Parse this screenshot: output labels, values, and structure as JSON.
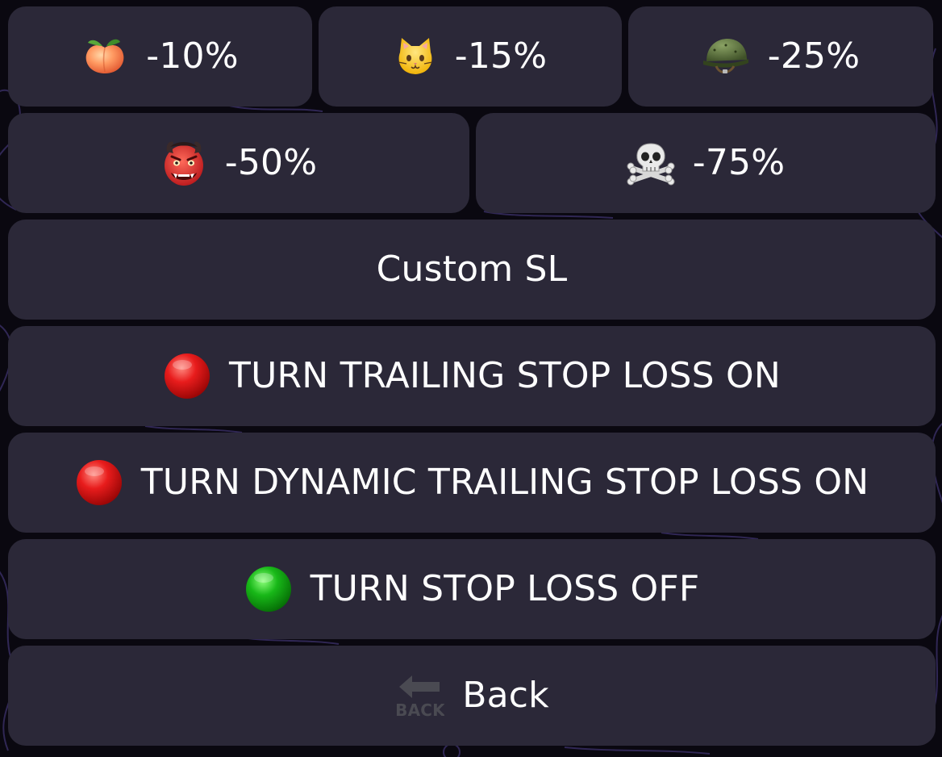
{
  "keyboard": {
    "row1": [
      {
        "icon": "peach-icon",
        "label": "-10%"
      },
      {
        "icon": "cat-face-icon",
        "label": "-15%"
      },
      {
        "icon": "military-helmet-icon",
        "label": "-25%"
      }
    ],
    "row2": [
      {
        "icon": "ogre-mask-icon",
        "label": "-50%"
      },
      {
        "icon": "skull-crossbones-icon",
        "label": "-75%"
      }
    ],
    "custom_sl": {
      "label": "Custom SL"
    },
    "trailing_stop_loss": {
      "icon": "red-circle-icon",
      "label": "TURN TRAILING STOP LOSS ON"
    },
    "dynamic_trailing_stop_loss": {
      "icon": "red-circle-icon",
      "label": "TURN DYNAMIC TRAILING STOP LOSS ON"
    },
    "stop_loss_off": {
      "icon": "green-circle-icon",
      "label": "TURN STOP LOSS OFF"
    },
    "back": {
      "icon": "back-arrow-icon",
      "icon_text": "BACK",
      "label": "Back"
    }
  },
  "colors": {
    "button_bg": "#2b2838",
    "page_bg": "#0a0810",
    "text": "#ffffff",
    "red_indicator": "#d81818",
    "green_indicator": "#1fb21f"
  }
}
